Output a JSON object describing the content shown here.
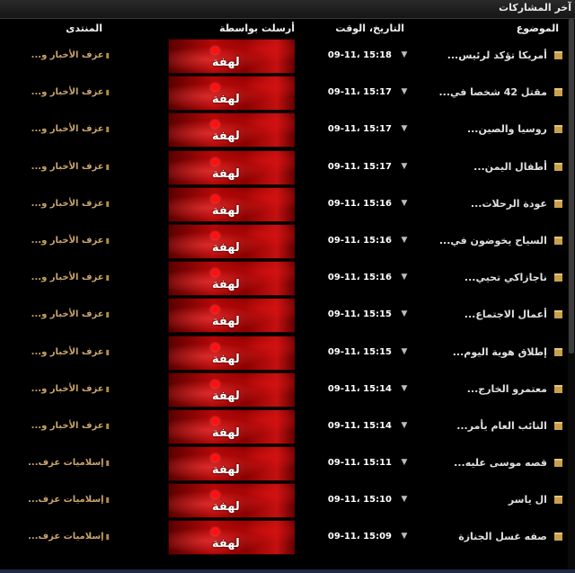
{
  "panel": {
    "title": "آخر المشاركات"
  },
  "columns": {
    "topic": "الموضوع",
    "date": "التاريخ، الوقت",
    "poster": "أرسلت بواسطة",
    "forum": "المنتدى"
  },
  "rows": [
    {
      "topic": "أمريكا تؤكد لرئيس...",
      "date": "09-11، 15:18",
      "poster": "لهفة",
      "forum": "عزف الأخبار و..."
    },
    {
      "topic": "مقتل 42 شخصا في...",
      "date": "09-11، 15:17",
      "poster": "لهفة",
      "forum": "عزف الأخبار و..."
    },
    {
      "topic": "روسيا والصين...",
      "date": "09-11، 15:17",
      "poster": "لهفة",
      "forum": "عزف الأخبار و..."
    },
    {
      "topic": "أطفال اليمن...",
      "date": "09-11، 15:17",
      "poster": "لهفة",
      "forum": "عزف الأخبار و..."
    },
    {
      "topic": "عودة الرحلات...",
      "date": "09-11، 15:16",
      "poster": "لهفة",
      "forum": "عزف الأخبار و..."
    },
    {
      "topic": "السياح يخوضون في...",
      "date": "09-11، 15:16",
      "poster": "لهفة",
      "forum": "عزف الأخبار و..."
    },
    {
      "topic": "ناجازاكي تحيي...",
      "date": "09-11، 15:16",
      "poster": "لهفة",
      "forum": "عزف الأخبار و..."
    },
    {
      "topic": "أعمال الاجتماع...",
      "date": "09-11، 15:15",
      "poster": "لهفة",
      "forum": "عزف الأخبار و..."
    },
    {
      "topic": "إطلاق هوية اليوم...",
      "date": "09-11، 15:15",
      "poster": "لهفة",
      "forum": "عزف الأخبار و..."
    },
    {
      "topic": "معتمرو الخارج...",
      "date": "09-11، 15:14",
      "poster": "لهفة",
      "forum": "عزف الأخبار و..."
    },
    {
      "topic": "النائب العام يأمر...",
      "date": "09-11، 15:14",
      "poster": "لهفة",
      "forum": "عزف الأخبار و..."
    },
    {
      "topic": "قصه موسى عليه...",
      "date": "09-11، 15:11",
      "poster": "لهفة",
      "forum": "إسلاميات عزف..."
    },
    {
      "topic": "ال ياسر",
      "date": "09-11، 15:10",
      "poster": "لهفة",
      "forum": "إسلاميات عزف..."
    },
    {
      "topic": "صفه غسل الجنازة",
      "date": "09-11، 15:09",
      "poster": "لهفة",
      "forum": "إسلاميات عزف..."
    }
  ],
  "icons": {
    "folder": "folder-icon",
    "arrow": "triangle-down-icon",
    "forum": "forum-icon"
  },
  "colors": {
    "background": "#000000",
    "forum_text": "#c9a56a",
    "avatar_red": "#b50808"
  }
}
